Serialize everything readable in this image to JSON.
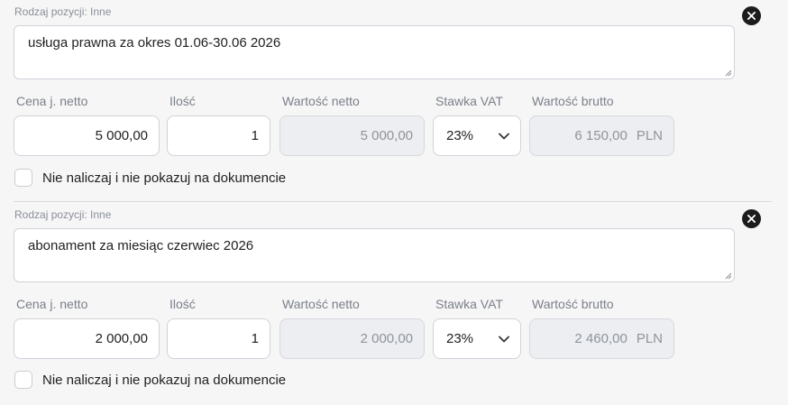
{
  "items": [
    {
      "type_label": "Rodzaj pozycji: Inne",
      "description": "usługa prawna za okres 01.06-30.06  2026",
      "labels": {
        "unit_price": "Cena j. netto",
        "quantity": "Ilość",
        "net_value": "Wartość netto",
        "vat_rate": "Stawka VAT",
        "gross_value": "Wartość brutto"
      },
      "unit_price": "5 000,00",
      "quantity": "1",
      "net_value": "5 000,00",
      "vat_rate": "23%",
      "gross_value": "6 150,00",
      "currency": "PLN",
      "checkbox_label": "Nie naliczaj i nie pokazuj na dokumencie",
      "checkbox_checked": false
    },
    {
      "type_label": "Rodzaj pozycji: Inne",
      "description": "abonament za miesiąc czerwiec 2026",
      "labels": {
        "unit_price": "Cena j. netto",
        "quantity": "Ilość",
        "net_value": "Wartość netto",
        "vat_rate": "Stawka VAT",
        "gross_value": "Wartość brutto"
      },
      "unit_price": "2 000,00",
      "quantity": "1",
      "net_value": "2 000,00",
      "vat_rate": "23%",
      "gross_value": "2 460,00",
      "currency": "PLN",
      "checkbox_label": "Nie naliczaj i nie pokazuj na dokumencie",
      "checkbox_checked": false
    }
  ],
  "icons": {
    "remove": "close-circle-icon",
    "select_arrow": "chevron-down-icon"
  },
  "colors": {
    "background": "#f6f6f7",
    "remove_button": "#1c1c1c",
    "readonly_field": "#eceef1",
    "border": "#cfd3d8"
  }
}
